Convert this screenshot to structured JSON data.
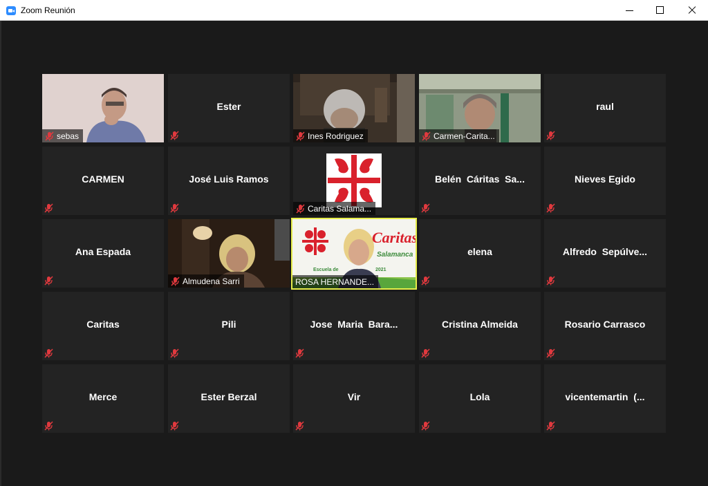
{
  "window": {
    "title": "Zoom Reunión",
    "controls": {
      "minimize": "minimize",
      "maximize": "maximize",
      "close": "close"
    }
  },
  "colors": {
    "background": "#1a1a1a",
    "tile": "#232323",
    "active_speaker_border": "#e6ed4a",
    "mute_icon": "#e0393e",
    "caritas_red": "#d9212c"
  },
  "participants": [
    {
      "name": "sebas",
      "video": true,
      "muted": true
    },
    {
      "name": "Ester",
      "video": false,
      "muted": true
    },
    {
      "name": "Ines Rodriguez",
      "video": true,
      "muted": true
    },
    {
      "name": "Carmen-Carita...",
      "video": true,
      "muted": true
    },
    {
      "name": "raul",
      "video": false,
      "muted": true
    },
    {
      "name": "CARMEN",
      "video": false,
      "muted": true
    },
    {
      "name": "José Luis Ramos",
      "video": false,
      "muted": true
    },
    {
      "name": "Caritas Salama...",
      "video": true,
      "muted": true
    },
    {
      "name": "Belén  Cáritas  Sa...",
      "video": false,
      "muted": true
    },
    {
      "name": "Nieves Egido",
      "video": false,
      "muted": true
    },
    {
      "name": "Ana Espada",
      "video": false,
      "muted": true
    },
    {
      "name": "Almudena Sarri",
      "video": true,
      "muted": true
    },
    {
      "name": "ROSA HERNANDE...",
      "video": true,
      "muted": false,
      "active_speaker": true
    },
    {
      "name": "elena",
      "video": false,
      "muted": true
    },
    {
      "name": "Alfredo  Sepúlve...",
      "video": false,
      "muted": true
    },
    {
      "name": "Caritas",
      "video": false,
      "muted": true
    },
    {
      "name": "Pili",
      "video": false,
      "muted": true
    },
    {
      "name": "Jose  Maria  Bara...",
      "video": false,
      "muted": true
    },
    {
      "name": "Cristina Almeida",
      "video": false,
      "muted": true
    },
    {
      "name": "Rosario Carrasco",
      "video": false,
      "muted": true
    },
    {
      "name": "Merce",
      "video": false,
      "muted": true
    },
    {
      "name": "Ester Berzal",
      "video": false,
      "muted": true
    },
    {
      "name": "Vir",
      "video": false,
      "muted": true
    },
    {
      "name": "Lola",
      "video": false,
      "muted": true
    },
    {
      "name": "vicentemartin  (...",
      "video": false,
      "muted": true
    }
  ],
  "rosa_video_text": {
    "brand": "Caritas",
    "city": "Salamanca",
    "caption": "Escuela de",
    "year": "2021"
  },
  "icons": {
    "muted": "muted-mic-icon",
    "app": "zoom-camera-icon"
  }
}
